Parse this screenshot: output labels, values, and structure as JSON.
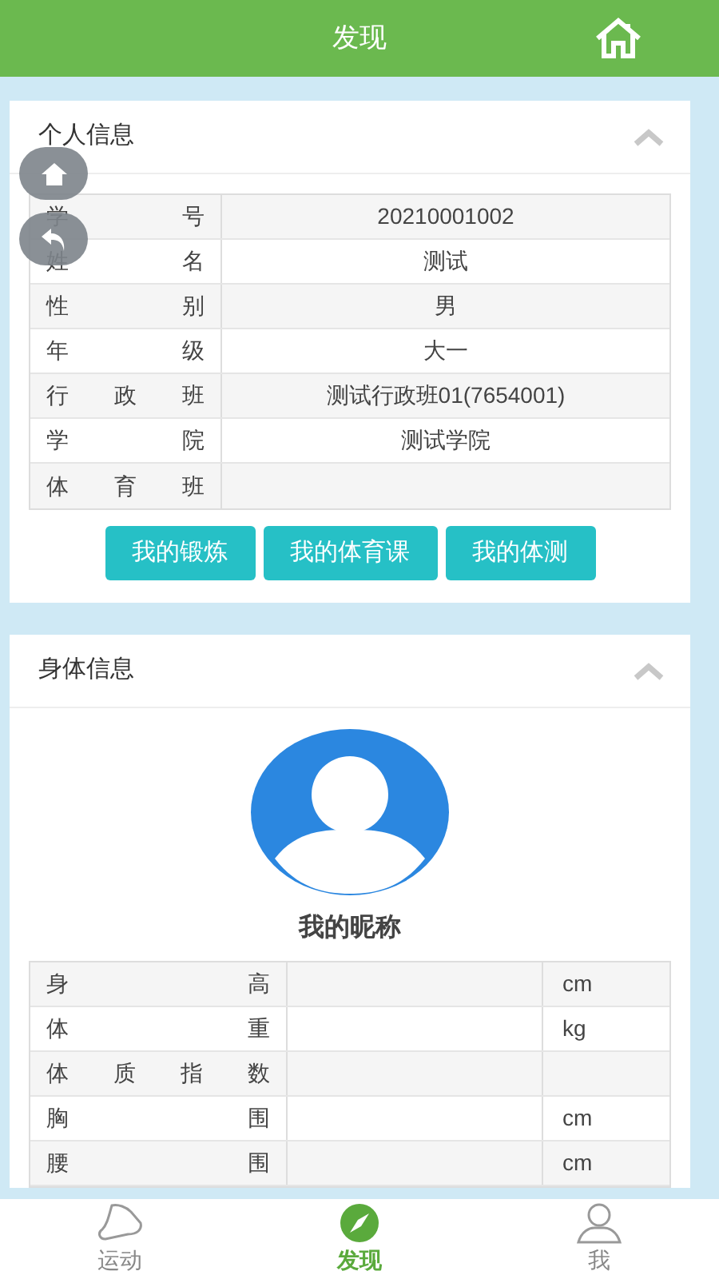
{
  "header": {
    "title": "发现"
  },
  "personal": {
    "title": "个人信息",
    "expanded": true,
    "rows": [
      {
        "label": "学 号",
        "value": "20210001002"
      },
      {
        "label": "姓 名",
        "value": "测试"
      },
      {
        "label": "性 别",
        "value": "男"
      },
      {
        "label": "年 级",
        "value": "大一"
      },
      {
        "label": "行 政 班",
        "value": "测试行政班01(7654001)"
      },
      {
        "label": "学 院",
        "value": "测试学院"
      },
      {
        "label": "体 育 班",
        "value": ""
      }
    ],
    "buttons": [
      "我的锻炼",
      "我的体育课",
      "我的体测"
    ]
  },
  "body": {
    "title": "身体信息",
    "expanded": true,
    "nickname": "我的昵称",
    "rows": [
      {
        "label": "身 高",
        "unit": "cm"
      },
      {
        "label": "体 重",
        "unit": "kg"
      },
      {
        "label": "体 质 指 数",
        "unit": ""
      },
      {
        "label": "胸 围",
        "unit": "cm"
      },
      {
        "label": "腰 围",
        "unit": "cm"
      }
    ]
  },
  "nav": [
    {
      "label": "运动",
      "kind": "shoe",
      "selected": false
    },
    {
      "label": "发现",
      "kind": "compass",
      "selected": true
    },
    {
      "label": "我",
      "kind": "person",
      "selected": false
    }
  ]
}
